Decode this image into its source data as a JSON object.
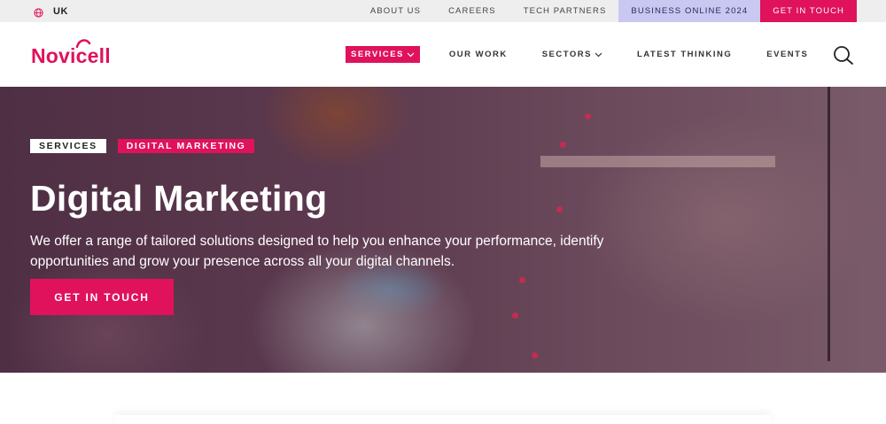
{
  "topbar": {
    "locale": "UK",
    "links": [
      "ABOUT US",
      "CAREERS",
      "TECH PARTNERS"
    ],
    "business_online": "BUSINESS ONLINE 2024",
    "get_in_touch": "GET IN TOUCH"
  },
  "header": {
    "logo": "Novicell",
    "nav": [
      "SERVICES",
      "OUR WORK",
      "SECTORS",
      "LATEST THINKING",
      "EVENTS"
    ]
  },
  "hero": {
    "tags": [
      "SERVICES",
      "DIGITAL MARKETING"
    ],
    "title": "Digital Marketing",
    "subtitle": "We offer a range of tailored solutions designed to help you enhance your performance, identify opportunities and grow your presence across all your digital channels.",
    "cta": "GET IN TOUCH"
  },
  "colors": {
    "brand_pink": "#e0125b",
    "lavender": "#c9c8f0",
    "topbar_bg": "#eeeeef"
  }
}
